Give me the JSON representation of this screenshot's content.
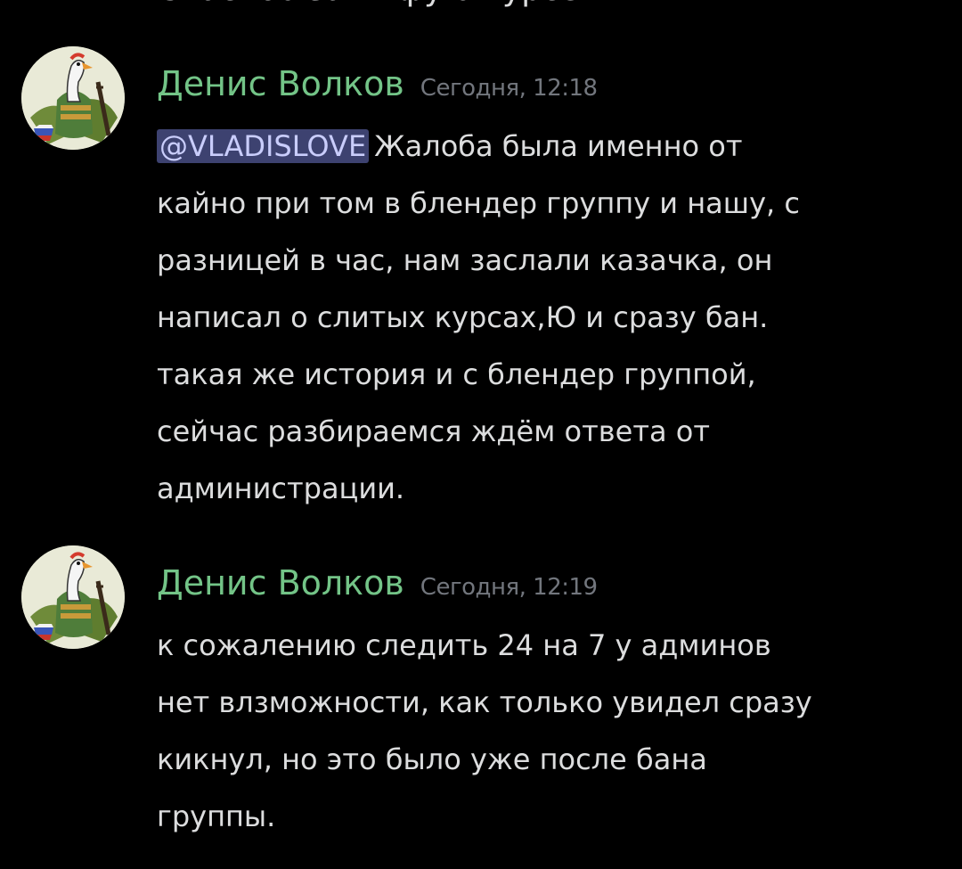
{
  "chat": {
    "partial_previous_line": "Спасибо за инфу о курсе",
    "messages": [
      {
        "author": "Денис Волков",
        "timestamp": "Сегодня, 12:18",
        "mention": "@VLADISLOVE",
        "lines": [
          "Жалоба была именно от",
          "кайно при том в блендер группу и нашу, с",
          "разницей в час, нам заслали казачка, он",
          "написал о слитых курсах,Ю и сразу бан.",
          "такая же история и с блендер группой,",
          "сейчас разбираемся ждём ответа от",
          "администрации."
        ]
      },
      {
        "author": "Денис Волков",
        "timestamp": "Сегодня, 12:19",
        "lines": [
          "к сожалению следить 24 на 7 у админов",
          "нет влзможности, как только увидел сразу",
          "кикнул, но это было уже после бана",
          "группы."
        ]
      }
    ]
  },
  "colors": {
    "background": "#000000",
    "author_name": "#73c487",
    "timestamp": "#72767d",
    "message_text": "#dcddde",
    "mention_bg": "#3d4270",
    "mention_text": "#c9cdfb"
  },
  "icons": {
    "avatar": "goose-with-rifle-avatar"
  }
}
